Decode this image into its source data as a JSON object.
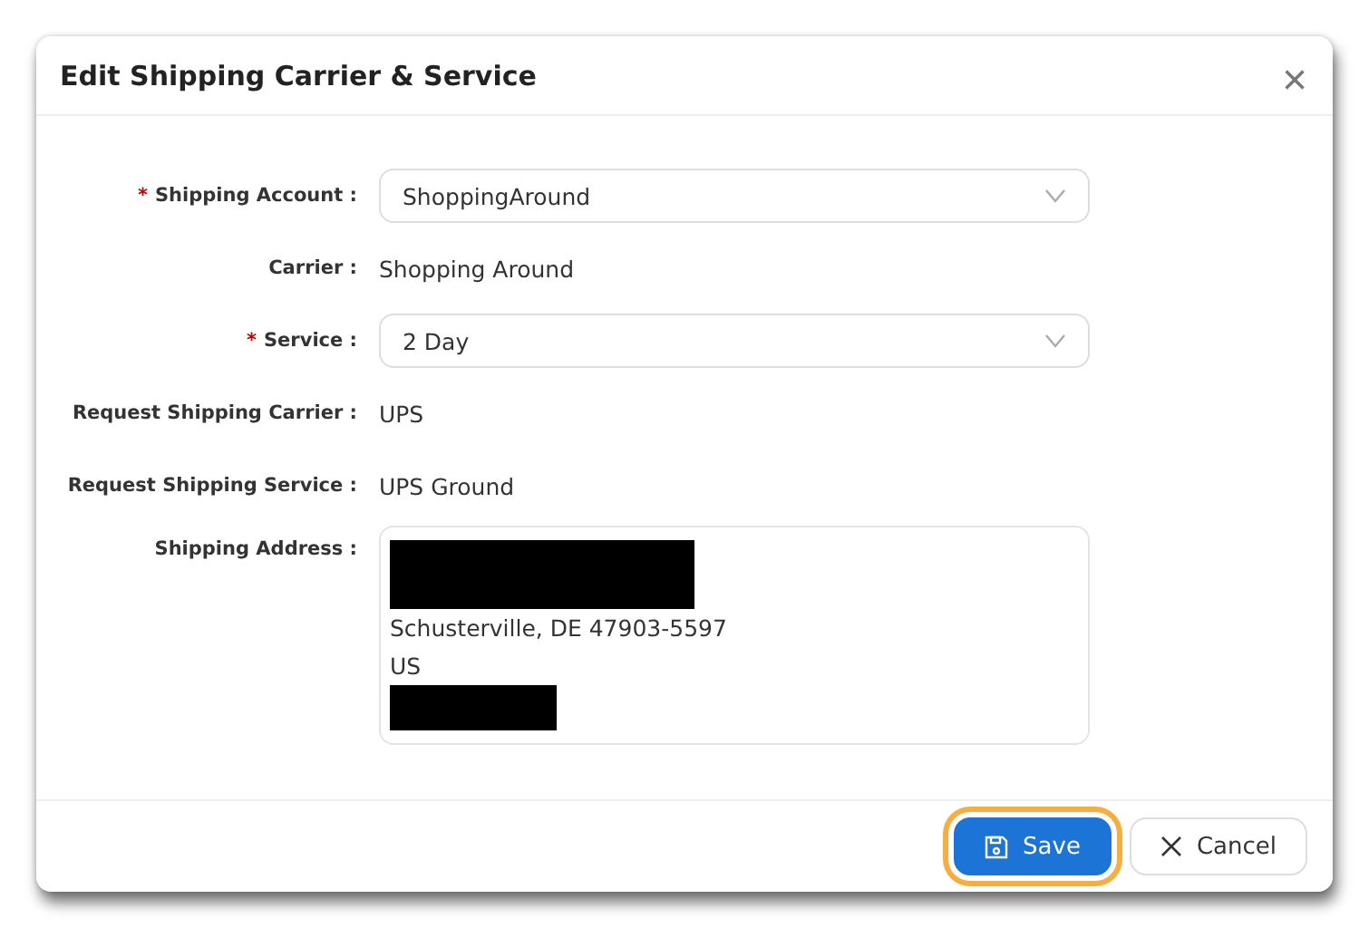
{
  "dialog": {
    "title": "Edit Shipping Carrier & Service",
    "close": "×"
  },
  "fields": [
    {
      "kind": "select",
      "label": "Shipping Account :",
      "required_mark": "*",
      "value": "ShoppingAround"
    },
    {
      "kind": "text",
      "label": "Carrier :",
      "value": "Shopping Around"
    },
    {
      "kind": "select",
      "label": "Service :",
      "required_mark": "*",
      "value": "2 Day"
    },
    {
      "kind": "text",
      "label": "Request Shipping Carrier :",
      "value": "UPS"
    },
    {
      "kind": "text",
      "label": "Request Shipping Service :",
      "value": "UPS Ground"
    },
    {
      "kind": "address",
      "label": "Shipping Address :",
      "lines": [
        {
          "kind": "redacted_block"
        },
        {
          "kind": "text",
          "text": "Schusterville, DE 47903-5597"
        },
        {
          "kind": "text",
          "text": "US"
        },
        {
          "kind": "redacted_line"
        }
      ]
    }
  ],
  "buttons": [
    {
      "kind": "primary",
      "label": "Save",
      "focused": true
    },
    {
      "kind": "secondary",
      "label": "Cancel",
      "focused": false
    }
  ]
}
